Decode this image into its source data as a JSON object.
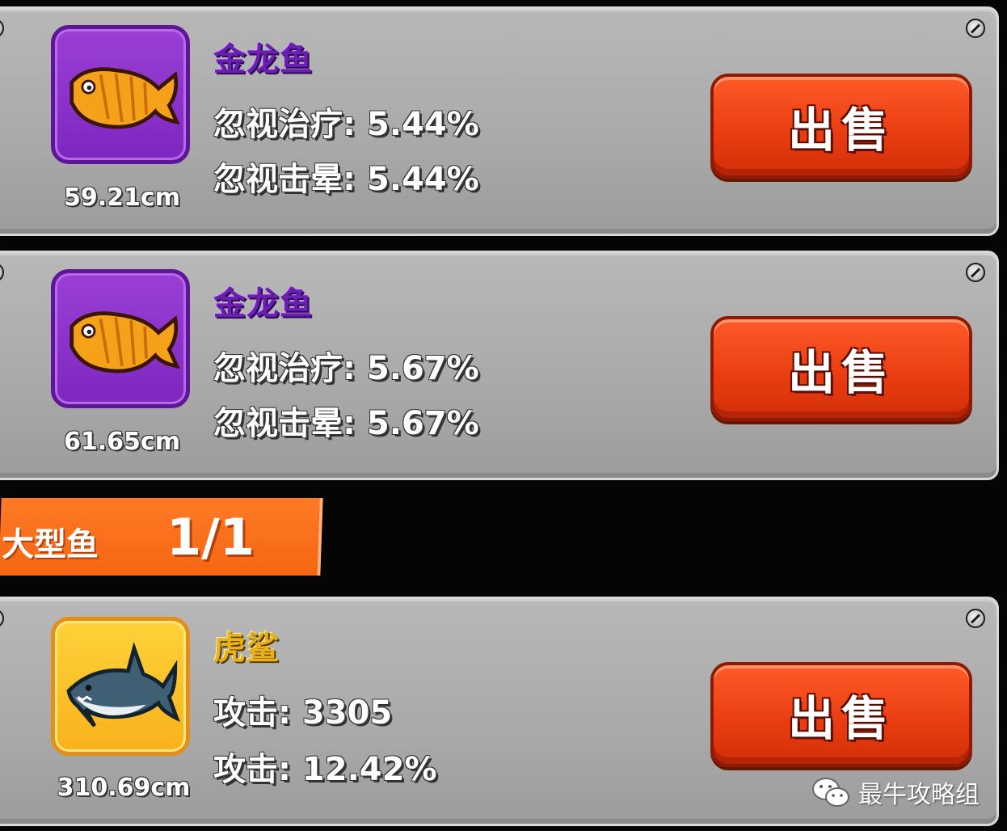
{
  "items": [
    {
      "name": "金龙鱼",
      "name_color": "purple",
      "size": "59.21cm",
      "stats": [
        "忽视治疗: 5.44%",
        "忽视击晕: 5.44%"
      ],
      "icon": "golden-arowana-icon",
      "sell_label": "出售"
    },
    {
      "name": "金龙鱼",
      "name_color": "purple",
      "size": "61.65cm",
      "stats": [
        "忽视治疗: 5.67%",
        "忽视击晕: 5.67%"
      ],
      "icon": "golden-arowana-icon",
      "sell_label": "出售"
    },
    {
      "name": "虎鲨",
      "name_color": "gold",
      "size": "310.69cm",
      "stats": [
        "攻击: 3305",
        "攻击: 12.42%"
      ],
      "icon": "tiger-shark-icon",
      "sell_label": "出售"
    }
  ],
  "category": {
    "label": "大型鱼",
    "count": "1/1"
  },
  "watermark": {
    "text": "最牛攻略组",
    "icon": "wechat-icon"
  },
  "colors": {
    "sell_button": "#e83c10",
    "category_bar": "#f56612",
    "rarity_purple": "#8a30c8",
    "rarity_gold": "#f7b21c"
  }
}
